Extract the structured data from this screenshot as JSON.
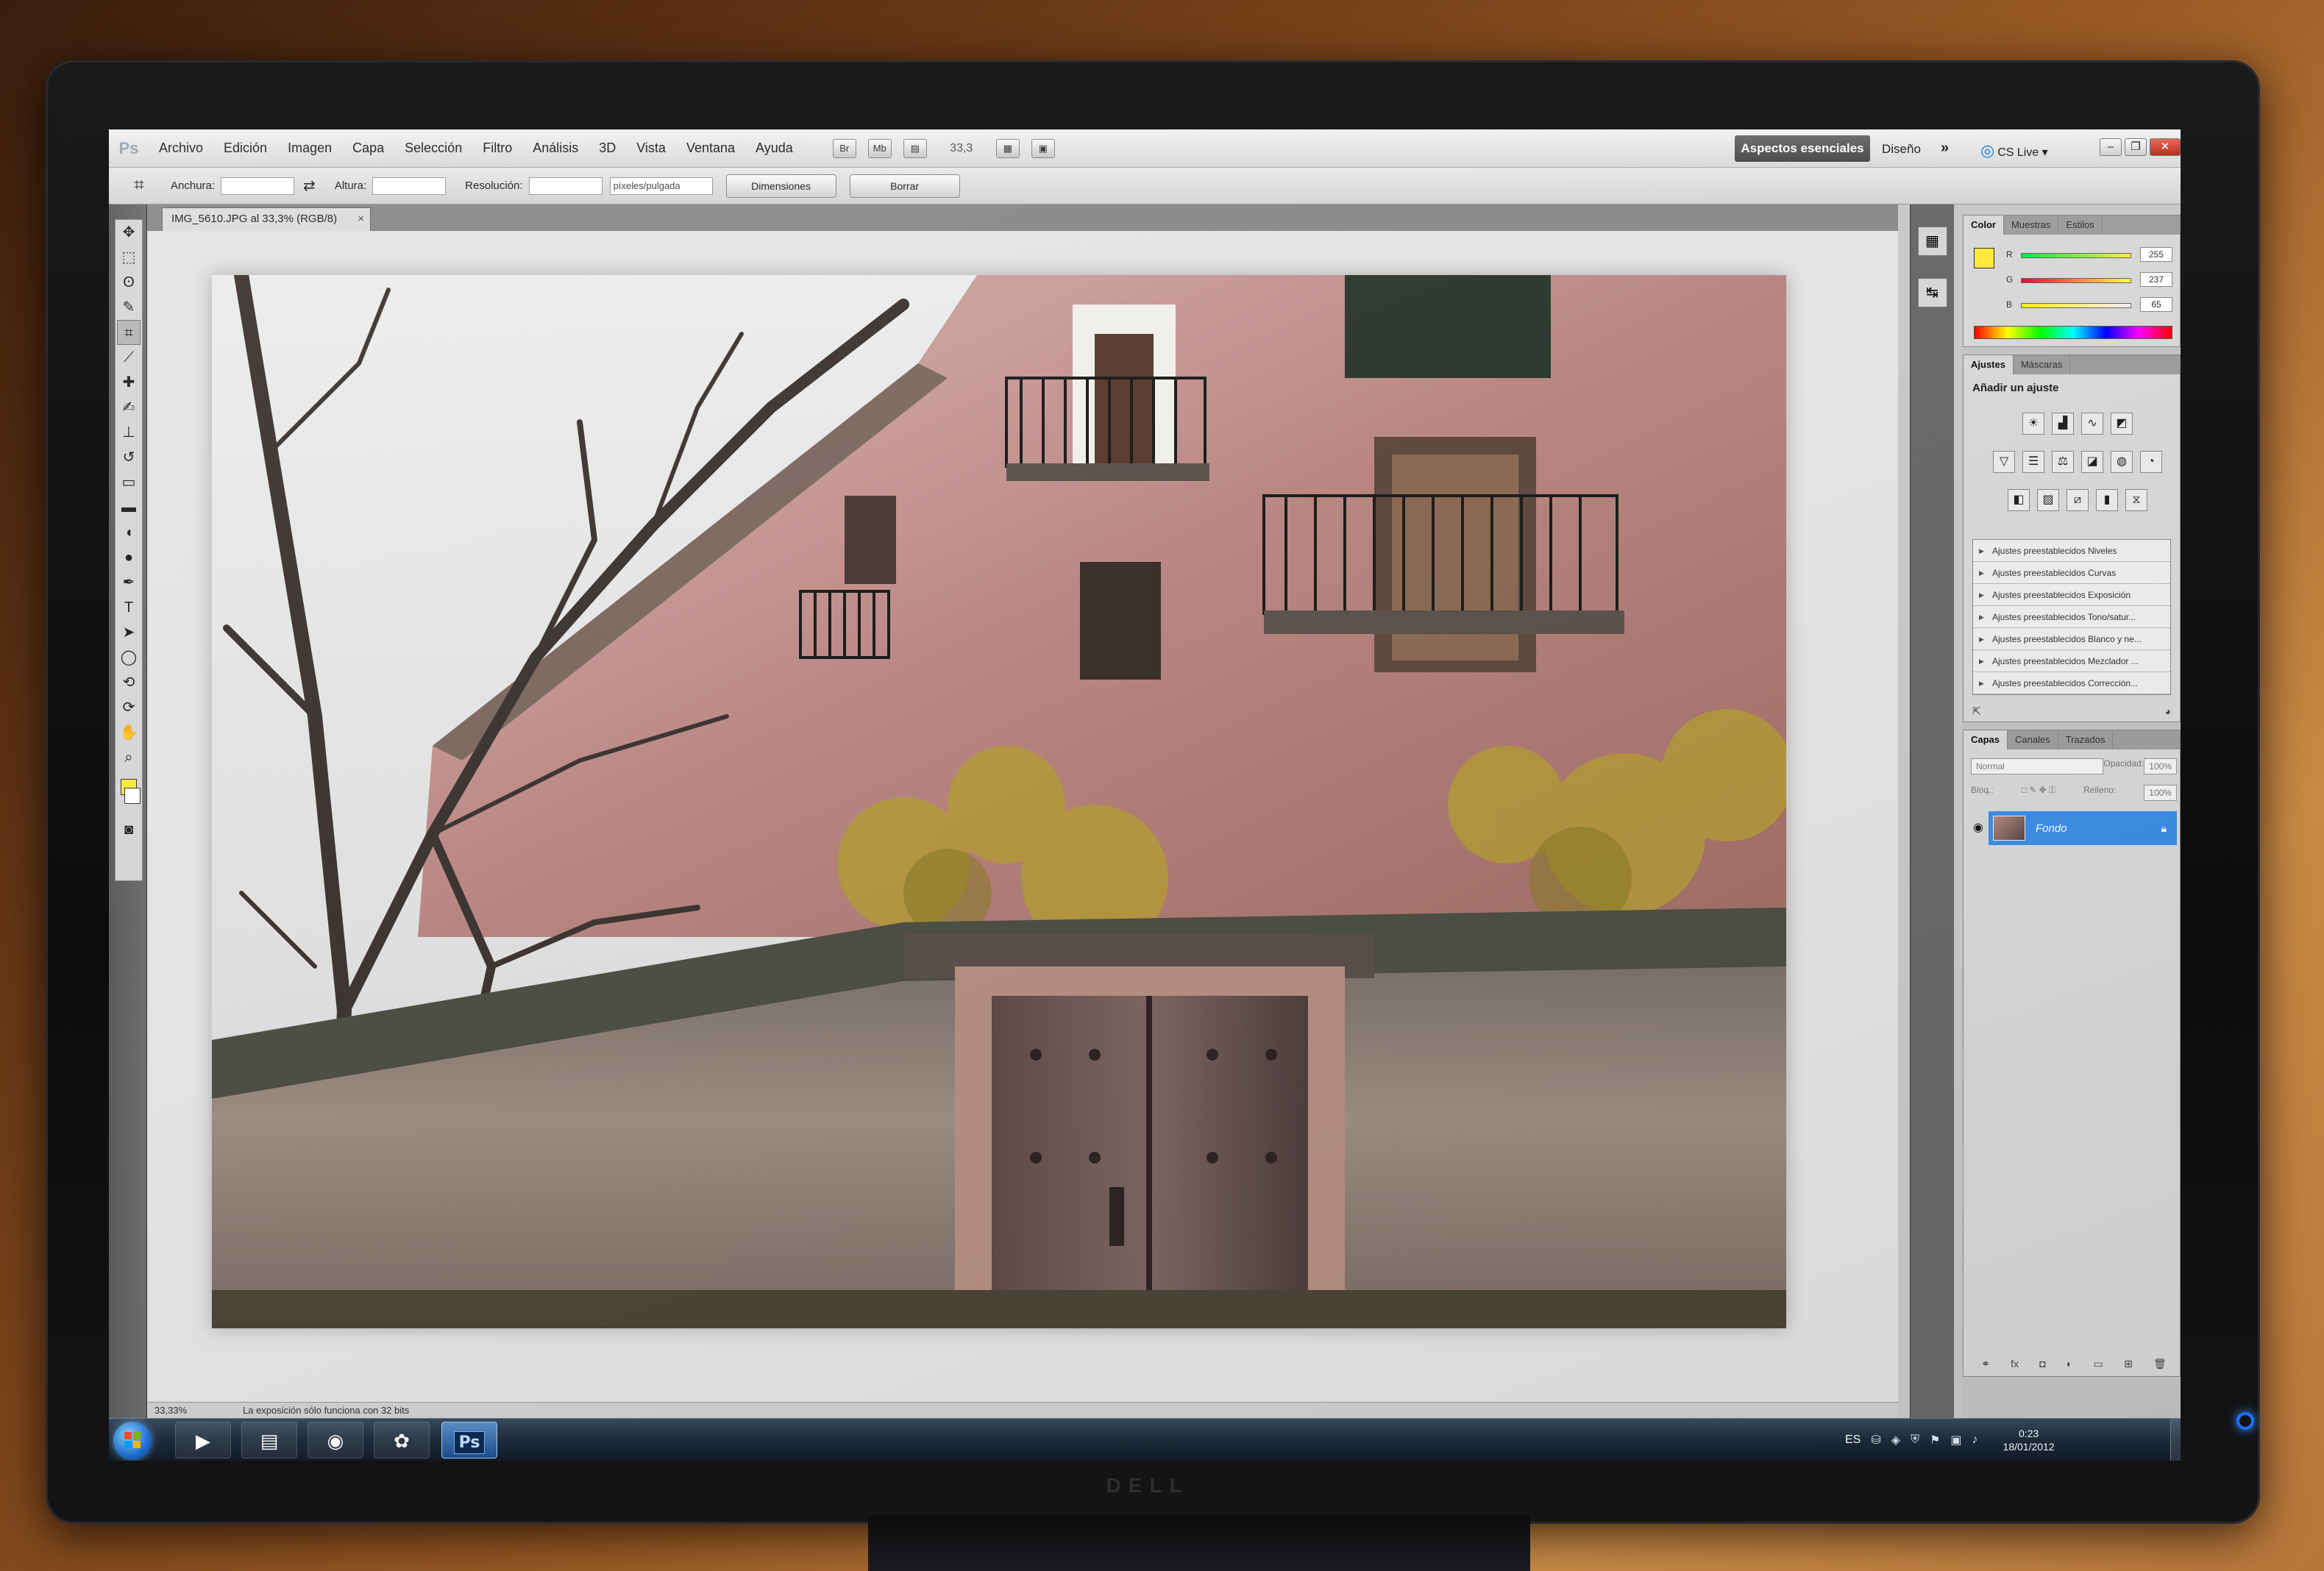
{
  "menubar": {
    "app_logo": "Ps",
    "items": [
      "Archivo",
      "Edición",
      "Imagen",
      "Capa",
      "Selección",
      "Filtro",
      "Análisis",
      "3D",
      "Vista",
      "Ventana",
      "Ayuda"
    ],
    "icon_br": "Br",
    "icon_mb": "Mb",
    "zoom": "33,3",
    "workspace_active": "Aspectos esenciales",
    "workspace_design": "Diseño",
    "workspace_more": "»",
    "cslive": "CS Live ▾"
  },
  "options": {
    "width_label": "Anchura:",
    "height_label": "Altura:",
    "resolution_label": "Resolución:",
    "units": "píxeles/pulgada",
    "dimensions_button": "Dimensiones",
    "clear_button": "Borrar"
  },
  "document": {
    "tab_title": "IMG_5610.JPG al 33,3% (RGB/8)",
    "tab_close": "×"
  },
  "status": {
    "zoom": "33,33%",
    "message": "La exposición sólo funciona con 32 bits"
  },
  "color_panel": {
    "tabs": [
      "Color",
      "Muestras",
      "Estilos"
    ],
    "active_tab": "Color",
    "fg_color": "#ffe93f",
    "r_label": "R",
    "g_label": "G",
    "b_label": "B",
    "r": "255",
    "g": "237",
    "b": "65"
  },
  "adjustments_panel": {
    "tabs": [
      "Ajustes",
      "Máscaras"
    ],
    "active_tab": "Ajustes",
    "title": "Añadir un ajuste",
    "presets": [
      "Ajustes preestablecidos Niveles",
      "Ajustes preestablecidos Curvas",
      "Ajustes preestablecidos Exposición",
      "Ajustes preestablecidos Tono/satur...",
      "Ajustes preestablecidos Blanco y ne...",
      "Ajustes preestablecidos Mezclador ...",
      "Ajustes preestablecidos Corrección..."
    ]
  },
  "layers_panel": {
    "tabs": [
      "Capas",
      "Canales",
      "Trazados"
    ],
    "active_tab": "Capas",
    "blend_mode": "Normal",
    "opacity_label": "Opacidad:",
    "opacity": "100%",
    "lock_label": "Bloq.:",
    "fill_label": "Relleno:",
    "fill": "100%",
    "layer_name": "Fondo"
  },
  "taskbar": {
    "ps_label": "Ps",
    "language": "ES",
    "time": "0:23",
    "date": "18/01/2012"
  },
  "monitor": {
    "brand": "DELL"
  },
  "colors": {
    "accent_layer": "#3d8ee6",
    "foreground": "#ffe93f"
  }
}
